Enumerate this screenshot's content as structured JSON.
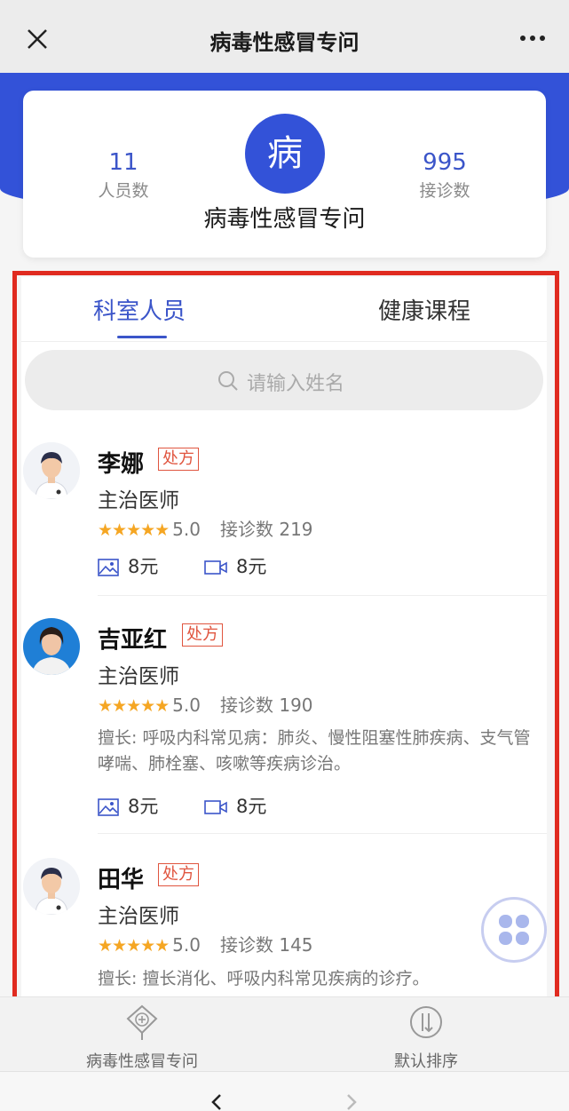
{
  "header": {
    "title": "病毒性感冒专问",
    "close_icon": "close-icon",
    "more_icon": "more-icon"
  },
  "dept_card": {
    "logo_char": "病",
    "name": "病毒性感冒专问",
    "staff_count": "11",
    "staff_label": "人员数",
    "consult_count": "995",
    "consult_label": "接诊数"
  },
  "tabs": [
    {
      "label": "科室人员",
      "active": true
    },
    {
      "label": "健康课程",
      "active": false
    }
  ],
  "search": {
    "placeholder": "请输入姓名"
  },
  "doctors": [
    {
      "name": "李娜",
      "badge": "处方",
      "title": "主治医师",
      "stars": "★★★★★",
      "score": "5.0",
      "consult": "接诊数 219",
      "specialty": "",
      "image_price": "8元",
      "video_price": "8元"
    },
    {
      "name": "吉亚红",
      "badge": "处方",
      "title": "主治医师",
      "stars": "★★★★★",
      "score": "5.0",
      "consult": "接诊数 190",
      "specialty": "擅长: 呼吸内科常见病：肺炎、慢性阻塞性肺疾病、支气管哮喘、肺栓塞、咳嗽等疾病诊治。",
      "image_price": "8元",
      "video_price": "8元"
    },
    {
      "name": "田华",
      "badge": "处方",
      "title": "主治医师",
      "stars": "★★★★★",
      "score": "5.0",
      "consult": "接诊数 145",
      "specialty": "擅长: 擅长消化、呼吸内科常见疾病的诊疗。",
      "image_price": "",
      "video_price": ""
    }
  ],
  "bottom_bar": {
    "left_label": "病毒性感冒专问",
    "right_label": "默认排序"
  },
  "colors": {
    "brand": "#3352d8",
    "accent": "#3b55c9",
    "star": "#f5a623",
    "badge": "#e0553f",
    "frame": "#e02b20"
  }
}
